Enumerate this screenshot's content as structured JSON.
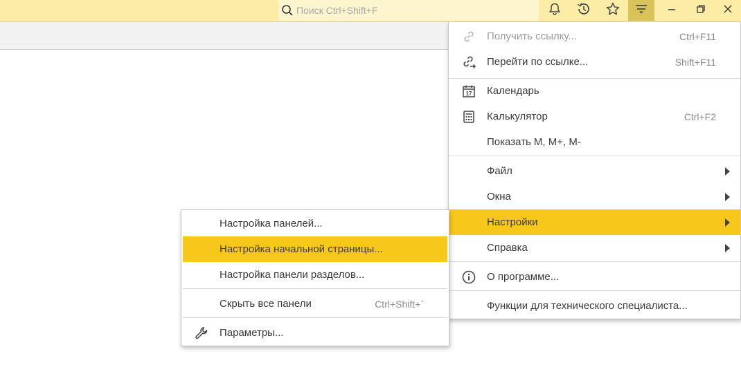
{
  "search": {
    "placeholder": "Поиск Ctrl+Shift+F"
  },
  "toolbar": {
    "icons": [
      "bell-icon",
      "history-icon",
      "star-icon",
      "menu-icon",
      "minimize-icon",
      "restore-icon",
      "close-icon"
    ]
  },
  "main_menu": {
    "items": [
      {
        "label": "Получить ссылку...",
        "shortcut": "Ctrl+F11",
        "icon": "link-icon",
        "disabled": true
      },
      {
        "label": "Перейти по ссылке...",
        "shortcut": "Shift+F11",
        "icon": "go-link-icon"
      },
      {
        "label": "Календарь",
        "shortcut": "",
        "icon": "calendar-icon",
        "icon_text": "17"
      },
      {
        "label": "Калькулятор",
        "shortcut": "Ctrl+F2",
        "icon": "calculator-icon"
      },
      {
        "label": "Показать M, M+, M-",
        "shortcut": ""
      },
      {
        "label": "Файл",
        "submenu": true
      },
      {
        "label": "Окна",
        "submenu": true
      },
      {
        "label": "Настройки",
        "submenu": true,
        "highlighted": true
      },
      {
        "label": "Справка",
        "submenu": true
      },
      {
        "label": "О программе...",
        "icon": "info-icon"
      },
      {
        "label": "Функции для технического специалиста..."
      }
    ]
  },
  "sub_menu": {
    "items": [
      {
        "label": "Настройка панелей..."
      },
      {
        "label": "Настройка начальной страницы...",
        "highlighted": true
      },
      {
        "label": "Настройка панели разделов..."
      },
      {
        "label": "Скрыть все панели",
        "shortcut": "Ctrl+Shift+`"
      },
      {
        "label": "Параметры...",
        "icon": "wrench-icon"
      }
    ]
  },
  "colors": {
    "topbar": "#fbeda6",
    "highlight": "#f7c81a",
    "active_button": "#d9c25a"
  }
}
